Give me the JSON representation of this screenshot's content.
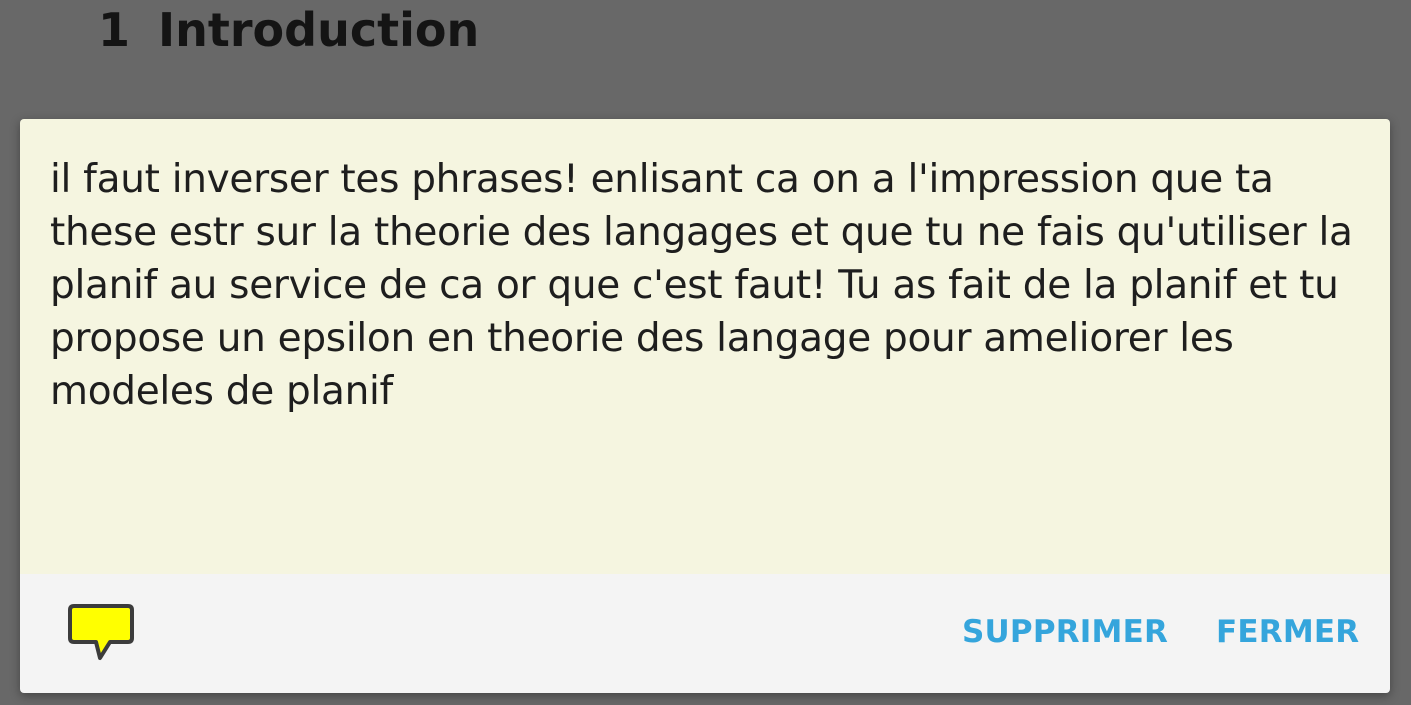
{
  "document": {
    "section_number": "1",
    "section_title": "Introduction"
  },
  "note_dialog": {
    "comment_text": "il faut inverser tes phrases! enlisant ca on a l'impression que ta these estr sur la theorie des langages et que tu ne fais qu'utiliser la planif au service de ca or que c'est faut! Tu as fait de la planif et tu propose un epsilon en theorie des langage pour ameliorer les modeles de planif",
    "icon": "speech-bubble-icon",
    "icon_color": "#ffff00",
    "delete_label": "SUPPRIMER",
    "close_label": "FERMER",
    "accent_color": "#35a5dc",
    "note_background": "#f5f5e0"
  }
}
